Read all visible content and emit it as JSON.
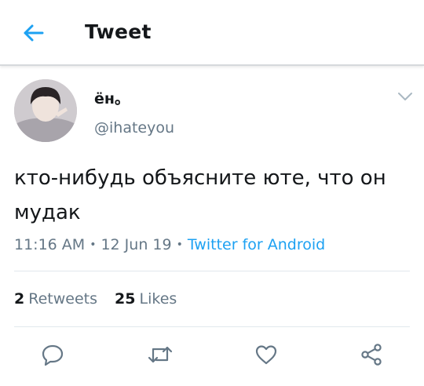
{
  "header": {
    "title": "Tweet",
    "back_icon": "arrow-left-icon",
    "accent_color": "#1da1f2"
  },
  "author": {
    "display_name": "ён。",
    "handle": "@ihateyou",
    "avatar": "user-avatar"
  },
  "tweet": {
    "text": "кто-нибудь объясните юте, что он мудак"
  },
  "meta": {
    "time": "11:16 AM",
    "date": "12 Jun 19",
    "separator": "•",
    "source": "Twitter for Android"
  },
  "stats": {
    "retweets_count": "2",
    "retweets_label": "Retweets",
    "likes_count": "25",
    "likes_label": "Likes"
  },
  "actions": {
    "reply_icon": "reply-icon",
    "retweet_icon": "retweet-icon",
    "like_icon": "heart-icon",
    "share_icon": "share-icon"
  }
}
